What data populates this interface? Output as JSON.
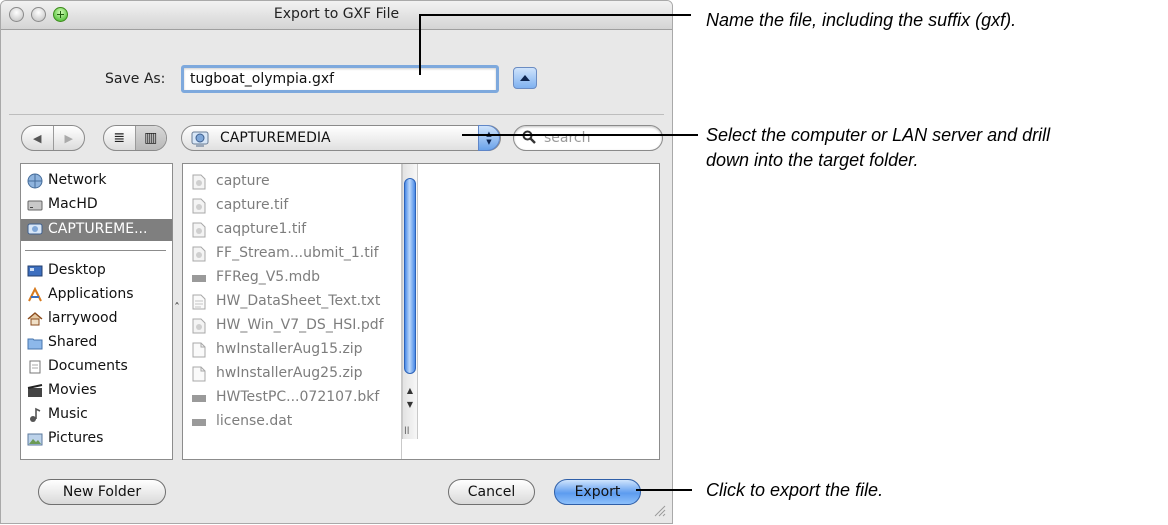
{
  "dialog": {
    "title": "Export to GXF File",
    "save_as_label": "Save As:",
    "filename_value": "tugboat_olympia.gxf",
    "location_label": "CAPTUREMEDIA",
    "search_placeholder": "search",
    "view_list_icon": "≣",
    "view_column_icon": "▥",
    "back_glyph": "◀",
    "forward_glyph": "▶"
  },
  "sidebar": {
    "items": [
      {
        "label": "Network",
        "icon": "network-icon"
      },
      {
        "label": "MacHD",
        "icon": "hard-drive-icon"
      },
      {
        "label": "CAPTUREME...",
        "icon": "server-icon",
        "selected": true
      },
      {
        "label": "Desktop",
        "icon": "desktop-icon"
      },
      {
        "label": "Applications",
        "icon": "applications-icon"
      },
      {
        "label": "larrywood",
        "icon": "home-icon"
      },
      {
        "label": "Shared",
        "icon": "folder-icon"
      },
      {
        "label": "Documents",
        "icon": "documents-icon"
      },
      {
        "label": "Movies",
        "icon": "movies-icon"
      },
      {
        "label": "Music",
        "icon": "music-icon"
      },
      {
        "label": "Pictures",
        "icon": "pictures-icon"
      }
    ]
  },
  "files": [
    {
      "name": "capture",
      "icon": "image-file-icon"
    },
    {
      "name": "capture.tif",
      "icon": "image-file-icon"
    },
    {
      "name": "caqpture1.tif",
      "icon": "image-file-icon"
    },
    {
      "name": "FF_Stream...ubmit_1.tif",
      "icon": "image-file-icon"
    },
    {
      "name": "FFReg_V5.mdb",
      "icon": "database-file-icon"
    },
    {
      "name": "HW_DataSheet_Text.txt",
      "icon": "text-file-icon"
    },
    {
      "name": "HW_Win_V7_DS_HSI.pdf",
      "icon": "image-file-icon"
    },
    {
      "name": "hwInstallerAug15.zip",
      "icon": "archive-file-icon"
    },
    {
      "name": "hwInstallerAug25.zip",
      "icon": "archive-file-icon"
    },
    {
      "name": "HWTestPC...072107.bkf",
      "icon": "database-file-icon"
    },
    {
      "name": "license.dat",
      "icon": "database-file-icon"
    }
  ],
  "buttons": {
    "new_folder": "New Folder",
    "cancel": "Cancel",
    "export": "Export"
  },
  "callouts": {
    "name_file": "Name the file, including the suffix (gxf).",
    "select_computer_line1": "Select the computer or LAN server and drill",
    "select_computer_line2": "down into the target folder.",
    "click_export": "Click to export the file."
  },
  "colors": {
    "accent_blue": "#5d9cef",
    "selected_sidebar": "#7f7f7f",
    "zoom_green": "#36b21f"
  }
}
